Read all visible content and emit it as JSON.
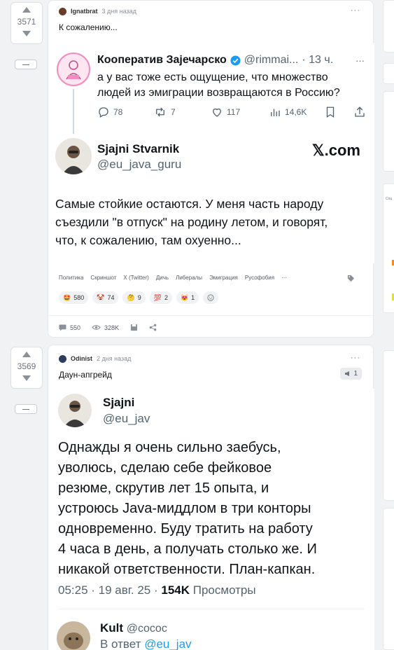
{
  "posts": [
    {
      "score": "3571",
      "author": "Ignatbrat",
      "time": "3 дня назад",
      "title": "К сожалению...",
      "tweet1": {
        "name": "Кооператив Зајечарско",
        "handle": "@rimmai...",
        "time": "· 13 ч.",
        "text1": "а у вас тоже есть ощущение, что множество",
        "text2": "людей из эмиграции возвращаются в Россию?",
        "replies": "78",
        "retweets": "7",
        "likes": "117",
        "views": "14,6K"
      },
      "tweet2": {
        "name": "Sjajni Stvarnik",
        "handle": "@eu_java_guru",
        "brand": "𝕏.com",
        "line1": "Самые стойкие остаются. У меня часть народу",
        "line2": "съездили \"в отпуск\" на родину летом, и говорят,",
        "line3": "что, к сожалению, там охуенно..."
      },
      "tags": [
        "Политика",
        "Скриншот",
        "X (Twitter)",
        "Дичь",
        "Либералы",
        "Эмиграция",
        "Русофобия",
        "···"
      ],
      "reactions": [
        {
          "emoji": "🤩",
          "count": "580"
        },
        {
          "emoji": "🤡",
          "count": "74"
        },
        {
          "emoji": "🤔",
          "count": "9"
        },
        {
          "emoji": "💯",
          "count": "2"
        },
        {
          "emoji": "😻",
          "count": "1"
        }
      ],
      "comments": "550",
      "views": "328K"
    },
    {
      "score": "3569",
      "author": "Odinist",
      "time": "2 дня назад",
      "title": "Даун-апгрейд",
      "badge": "1",
      "tweet": {
        "name": "Sjajni",
        "handle": "@eu_jav",
        "lines": [
          "Однажды я очень сильно заебусь,",
          "уволюсь, сделаю себе фейковое",
          "резюме, скрутив лет 15 опыта, и",
          "устроюсь Java-миддлом в три конторы",
          "одновременно. Буду тратить на работу",
          "4 часа в день, а получать столько же. И",
          "никакой ответственности. План-капкан."
        ],
        "meta_time": "05:25 · 19 авг. 25 ·",
        "meta_views": "154K",
        "meta_views_label": "Просмотры"
      },
      "reply": {
        "name": "Kult",
        "handle": "@cocoс",
        "reply_to": "В ответ",
        "reply_handle": "@eu_jav"
      }
    }
  ],
  "sidebar": {
    "label": "Соц"
  },
  "colors": {
    "accent": "#1d9bf0",
    "verified": "#1d9bf0",
    "muted": "#536471"
  },
  "icons": [
    "reply-icon",
    "retweet-icon",
    "like-icon",
    "views-icon",
    "bookmark-icon",
    "share-icon",
    "comment-icon",
    "eye-icon",
    "save-icon",
    "share-post-icon",
    "tag-icon",
    "add-reaction-icon",
    "megaphone-icon"
  ]
}
